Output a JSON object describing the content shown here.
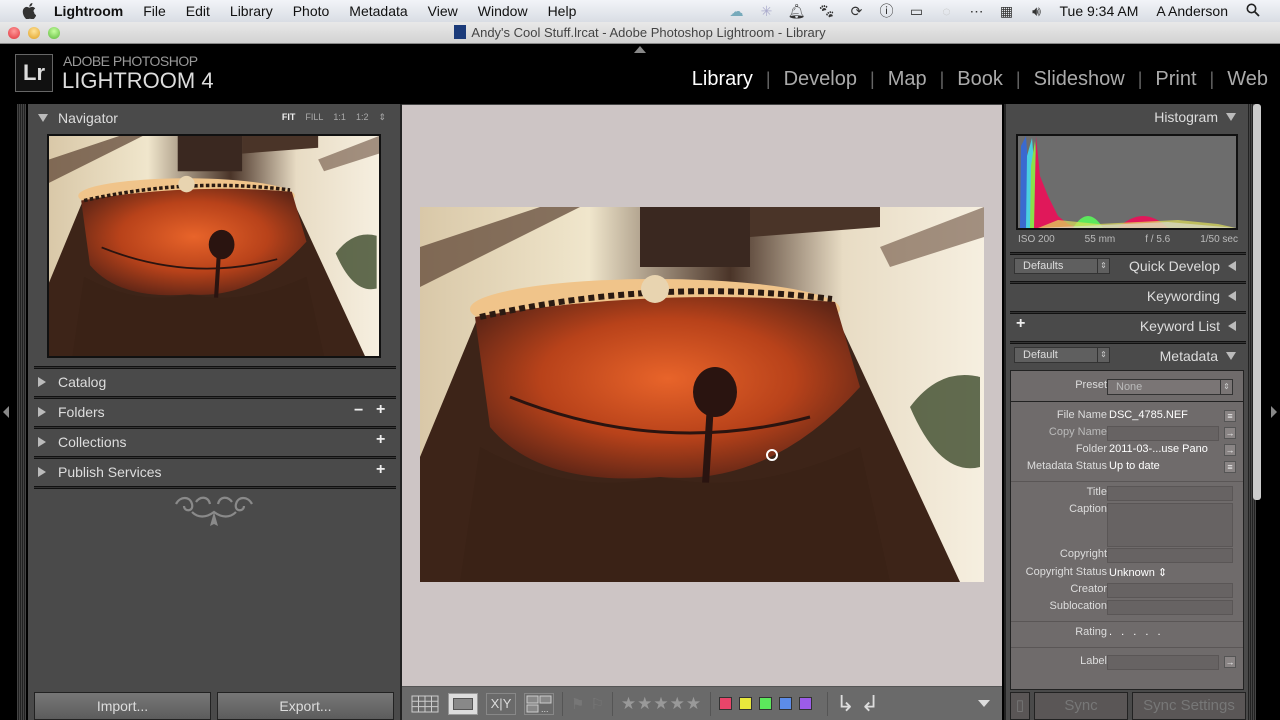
{
  "menubar": {
    "app_name": "Lightroom",
    "items": [
      "File",
      "Edit",
      "Library",
      "Photo",
      "Metadata",
      "View",
      "Window",
      "Help"
    ],
    "status_icons": [
      "cloud-sync-icon",
      "bluetooth-icon",
      "notification-bell-icon",
      "paw-icon",
      "sync-icon",
      "accessibility-icon",
      "display-icon",
      "timemachine-icon",
      "more-icon",
      "calendar-icon",
      "volume-icon"
    ],
    "clock": "Tue 9:34 AM",
    "user": "A Anderson"
  },
  "window": {
    "title": "Andy's Cool Stuff.lrcat - Adobe Photoshop Lightroom - Library"
  },
  "identity": {
    "logo": "Lr",
    "line1": "ADOBE PHOTOSHOP",
    "line2": "LIGHTROOM 4"
  },
  "modules": [
    {
      "label": "Library",
      "active": true
    },
    {
      "label": "Develop",
      "active": false
    },
    {
      "label": "Map",
      "active": false
    },
    {
      "label": "Book",
      "active": false
    },
    {
      "label": "Slideshow",
      "active": false
    },
    {
      "label": "Print",
      "active": false
    },
    {
      "label": "Web",
      "active": false
    }
  ],
  "left_panel": {
    "navigator": {
      "title": "Navigator",
      "zoom_options": [
        "FIT",
        "FILL",
        "1:1",
        "1:2"
      ],
      "active_zoom": "FIT"
    },
    "sections": [
      {
        "label": "Catalog"
      },
      {
        "label": "Folders"
      },
      {
        "label": "Collections"
      },
      {
        "label": "Publish Services"
      }
    ],
    "import_label": "Import...",
    "export_label": "Export..."
  },
  "toolbar": {
    "views": [
      "grid-view-icon",
      "loupe-view-icon",
      "compare-view-icon",
      "survey-view-icon"
    ],
    "compare_label": "X|Y",
    "rating_stars": 5,
    "color_labels": [
      "#e8456a",
      "#e8e83c",
      "#5ce85c",
      "#5c8ce8",
      "#9c5ce8"
    ]
  },
  "right_panel": {
    "histogram": {
      "title": "Histogram",
      "iso": "ISO 200",
      "focal": "55 mm",
      "aperture": "f / 5.6",
      "shutter": "1/50 sec"
    },
    "quick_develop": {
      "title": "Quick Develop",
      "preset": "Defaults"
    },
    "keywording": {
      "title": "Keywording"
    },
    "keyword_list": {
      "title": "Keyword List"
    },
    "metadata": {
      "title": "Metadata",
      "preset_select": "Default",
      "preset_label": "Preset",
      "preset_value": "None",
      "fields": {
        "file_name_label": "File Name",
        "file_name": "DSC_4785.NEF",
        "copy_name_label": "Copy Name",
        "copy_name": "",
        "folder_label": "Folder",
        "folder": "2011-03-...use Pano",
        "status_label": "Metadata Status",
        "status": "Up to date",
        "title_label": "Title",
        "caption_label": "Caption",
        "copyright_label": "Copyright",
        "copyright_status_label": "Copyright Status",
        "copyright_status": "Unknown",
        "creator_label": "Creator",
        "sublocation_label": "Sublocation",
        "rating_label": "Rating",
        "rating": ". . . . .",
        "label_label": "Label"
      }
    },
    "sync_label": "Sync",
    "sync_settings_label": "Sync Settings"
  }
}
